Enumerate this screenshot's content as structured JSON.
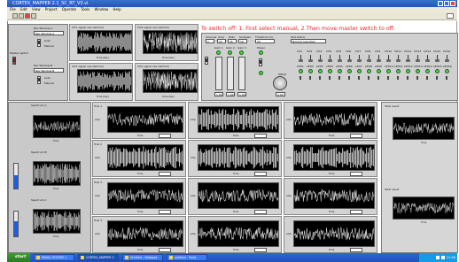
{
  "window": {
    "title": "CORTEX_MAPPER 2.1_SC_RT_V3.vi"
  },
  "menu": {
    "items": [
      "File",
      "Edit",
      "View",
      "Project",
      "Operate",
      "Tools",
      "Window",
      "Help"
    ]
  },
  "warning": {
    "text": "To switch off: 1. First select manual, 2.Then move master switch to off."
  },
  "top_left": {
    "master_label": "Master switch",
    "rec_a_title": "Rec Window A",
    "rec_a_value": "Rec Window A",
    "rec_b_title": "Rec Window B",
    "rec_b_value": "Rec Window B",
    "auto_label": "Auto",
    "manual_label": "Manual"
  },
  "upper_plots": [
    {
      "title": "CH1 signal raw (ΔV/mV)",
      "xlabel": "Time (Sec)"
    },
    {
      "title": "CH2 signal raw (ΔV/mV)",
      "xlabel": "Time (Sec)"
    },
    {
      "title": "CH3 signal raw (ΔV/mV)",
      "xlabel": "Time (Sec)"
    },
    {
      "title": "CH4 signal raw (ΔV/mV)",
      "xlabel": "Time (Sec)"
    }
  ],
  "controls": {
    "col_labels": [
      "Channel",
      "Amp",
      "Rate",
      "Samples"
    ],
    "col_values": [
      "1",
      "12",
      "25",
      "10"
    ],
    "threshold_label": "Threshold (V)",
    "threshold_value": "10",
    "test_label": "Test status",
    "test_value": "Normal operation",
    "knob_labels": [
      "Gain 1",
      "Gain 2",
      "Gain 3",
      "Offset"
    ],
    "knob_values": [
      "1.00",
      "1.00",
      "1.00",
      "0.00"
    ],
    "power_label": "Power"
  },
  "channel_row": {
    "labels": [
      "CH1",
      "CH2",
      "CH3",
      "CH4",
      "CH5",
      "CH6",
      "CH7",
      "CH8",
      "CH9",
      "CH10",
      "CH11",
      "CH12",
      "CH13",
      "CH14",
      "CH15",
      "CH16"
    ],
    "led_labels": [
      "LED1",
      "LED2",
      "LED3",
      "LED4",
      "LED5",
      "LED6",
      "LED7",
      "LED8",
      "LED9",
      "LED10",
      "LED11",
      "LED12",
      "LED13",
      "LED14",
      "LED15",
      "LED16"
    ]
  },
  "bottom_left": {
    "section_a_title": "Spectrum A",
    "section_b_title": "Spectrum B",
    "section_c_title": "Spectrum C",
    "amplitude_label": "Amplitude",
    "time_label": "Time"
  },
  "grid": {
    "rows": 4,
    "cols": 3,
    "row_labels": [
      "Trial 1",
      "Trial 2",
      "Trial 3",
      "Trial 4"
    ],
    "xlabel": "Time",
    "ylabel": "Amp"
  },
  "right_col": {
    "top_title": "Total result",
    "bottom_title": "Total result",
    "xlabel": "Time"
  },
  "taskbar": {
    "start": "start",
    "tasks": [
      "NIDAQ SYSTEM 1",
      "CORTEX_MAPPER 2",
      "Untitled - Notepad",
      "untitled - Paint"
    ],
    "clock": "11:46"
  }
}
